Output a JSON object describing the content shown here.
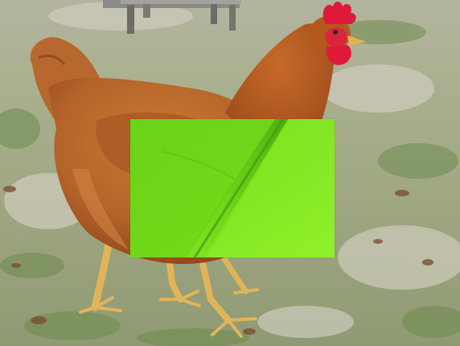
{
  "scene": {
    "subject": "chicken",
    "background": "grass",
    "colors": {
      "ground_light": "#c9c6b3",
      "grass": "#8fa86c",
      "grass_dark": "#5f7d45",
      "feather": "#b9672b",
      "feather_dark": "#8e4418",
      "feather_light": "#d59052",
      "comb": "#e0183a",
      "legs": "#e2b45a",
      "occluder_green": "#7be41c",
      "occluder_fold": "#4fb70f"
    }
  }
}
